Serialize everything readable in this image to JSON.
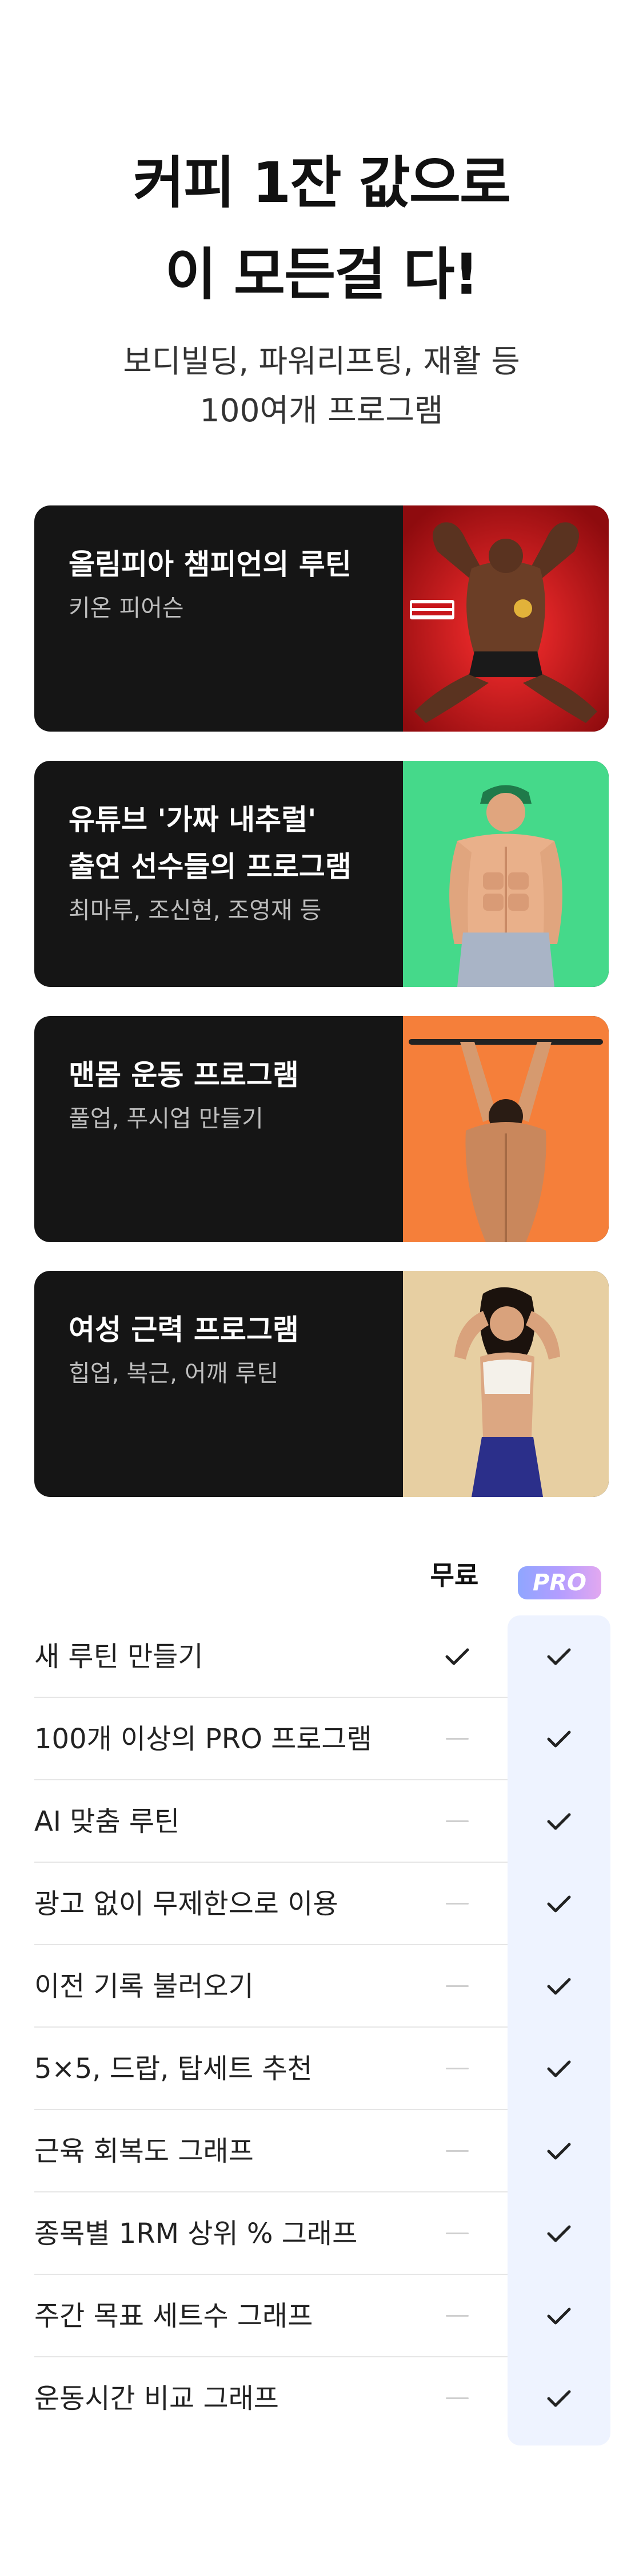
{
  "hero": {
    "title_line1": "커피 1잔 값으로",
    "title_line2": "이 모든걸 다!",
    "subtitle_line1": "보디빌딩, 파워리프팅, 재활 등",
    "subtitle_line2": "100여개 프로그램"
  },
  "cards": [
    {
      "title_lines": [
        "올림피아 챔피언의 루틴"
      ],
      "subtitle": "키온 피어슨",
      "image_bg": "#c8161b",
      "image_icon": "bodybuilder-champion-photo"
    },
    {
      "title_lines": [
        "유튜브 '가짜 내추럴'",
        "출연 선수들의 프로그램"
      ],
      "subtitle": "최마루, 조신현, 조영재 등",
      "image_bg": "#45d98a",
      "image_icon": "fitness-model-photo"
    },
    {
      "title_lines": [
        "맨몸 운동 프로그램"
      ],
      "subtitle": "풀업, 푸시업 만들기",
      "image_bg": "#f57f3a",
      "image_icon": "pullup-back-photo"
    },
    {
      "title_lines": [
        "여성 근력 프로그램"
      ],
      "subtitle": "힙업, 복근, 어깨 루틴",
      "image_bg": "#e7cfa2",
      "image_icon": "female-athlete-photo"
    }
  ],
  "comparison": {
    "free_label": "무료",
    "pro_label": "PRO",
    "rows": [
      {
        "label": "새 루틴 만들기",
        "free": true,
        "pro": true
      },
      {
        "label": "100개 이상의 PRO 프로그램",
        "free": false,
        "pro": true
      },
      {
        "label": "AI 맞춤 루틴",
        "free": false,
        "pro": true
      },
      {
        "label": "광고 없이 무제한으로 이용",
        "free": false,
        "pro": true
      },
      {
        "label": "이전 기록 불러오기",
        "free": false,
        "pro": true
      },
      {
        "label": "5×5, 드랍, 탑세트 추천",
        "free": false,
        "pro": true
      },
      {
        "label": "근육 회복도 그래프",
        "free": false,
        "pro": true
      },
      {
        "label": "종목별 1RM 상위 % 그래프",
        "free": false,
        "pro": true
      },
      {
        "label": "주간 목표 세트수 그래프",
        "free": false,
        "pro": true
      },
      {
        "label": "운동시간 비교 그래프",
        "free": false,
        "pro": true
      }
    ]
  },
  "colors": {
    "card_bg": "#151515",
    "pro_column_bg": "#eef3ff",
    "check": "#222222",
    "dash": "#cfcfcf"
  }
}
